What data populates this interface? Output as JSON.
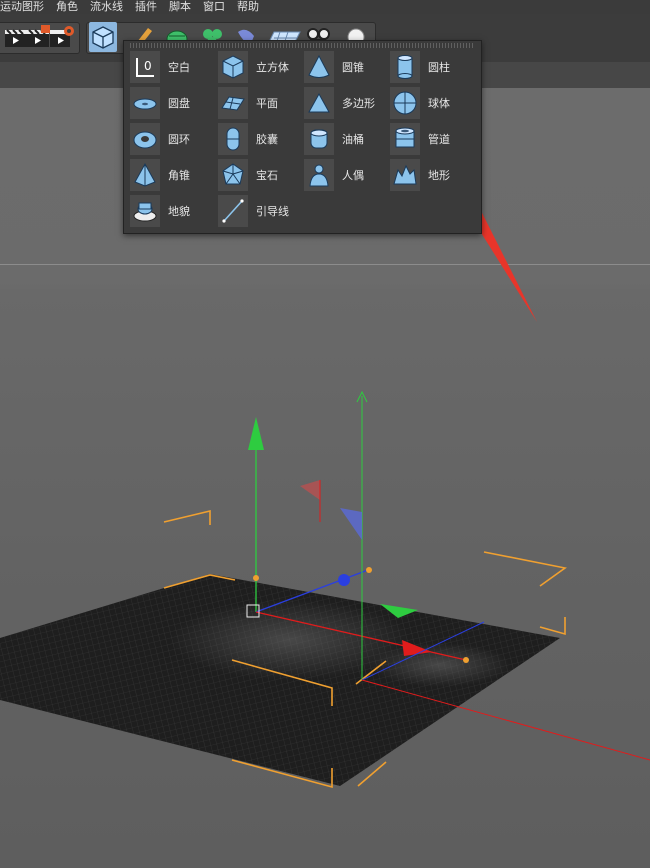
{
  "menu": [
    "运动图形",
    "角色",
    "流水线",
    "插件",
    "脚本",
    "窗口",
    "帮助"
  ],
  "popup": {
    "items": [
      {
        "label": "空白",
        "icon": "null-object-icon"
      },
      {
        "label": "立方体",
        "icon": "cube-icon"
      },
      {
        "label": "圆锥",
        "icon": "cone-icon"
      },
      {
        "label": "圆柱",
        "icon": "cylinder-icon"
      },
      {
        "label": "圆盘",
        "icon": "disc-icon"
      },
      {
        "label": "平面",
        "icon": "plane-icon"
      },
      {
        "label": "多边形",
        "icon": "polygon-icon"
      },
      {
        "label": "球体",
        "icon": "sphere-icon"
      },
      {
        "label": "圆环",
        "icon": "torus-icon"
      },
      {
        "label": "胶囊",
        "icon": "capsule-icon"
      },
      {
        "label": "油桶",
        "icon": "oil-tank-icon"
      },
      {
        "label": "管道",
        "icon": "tube-icon"
      },
      {
        "label": "角锥",
        "icon": "pyramid-icon"
      },
      {
        "label": "宝石",
        "icon": "platonic-icon"
      },
      {
        "label": "人偶",
        "icon": "figure-icon"
      },
      {
        "label": "地形",
        "icon": "landscape-icon"
      },
      {
        "label": "地貌",
        "icon": "relief-icon"
      },
      {
        "label": "引导线",
        "icon": "guide-line-icon"
      }
    ]
  },
  "colors": {
    "accent_blue": "#8cc4ec",
    "annotation_red": "#e8352a",
    "axis_green": "#2ecc40",
    "axis_red": "#e01c1c",
    "axis_blue": "#2a3fe0",
    "bbox_orange": "#f0a030"
  }
}
